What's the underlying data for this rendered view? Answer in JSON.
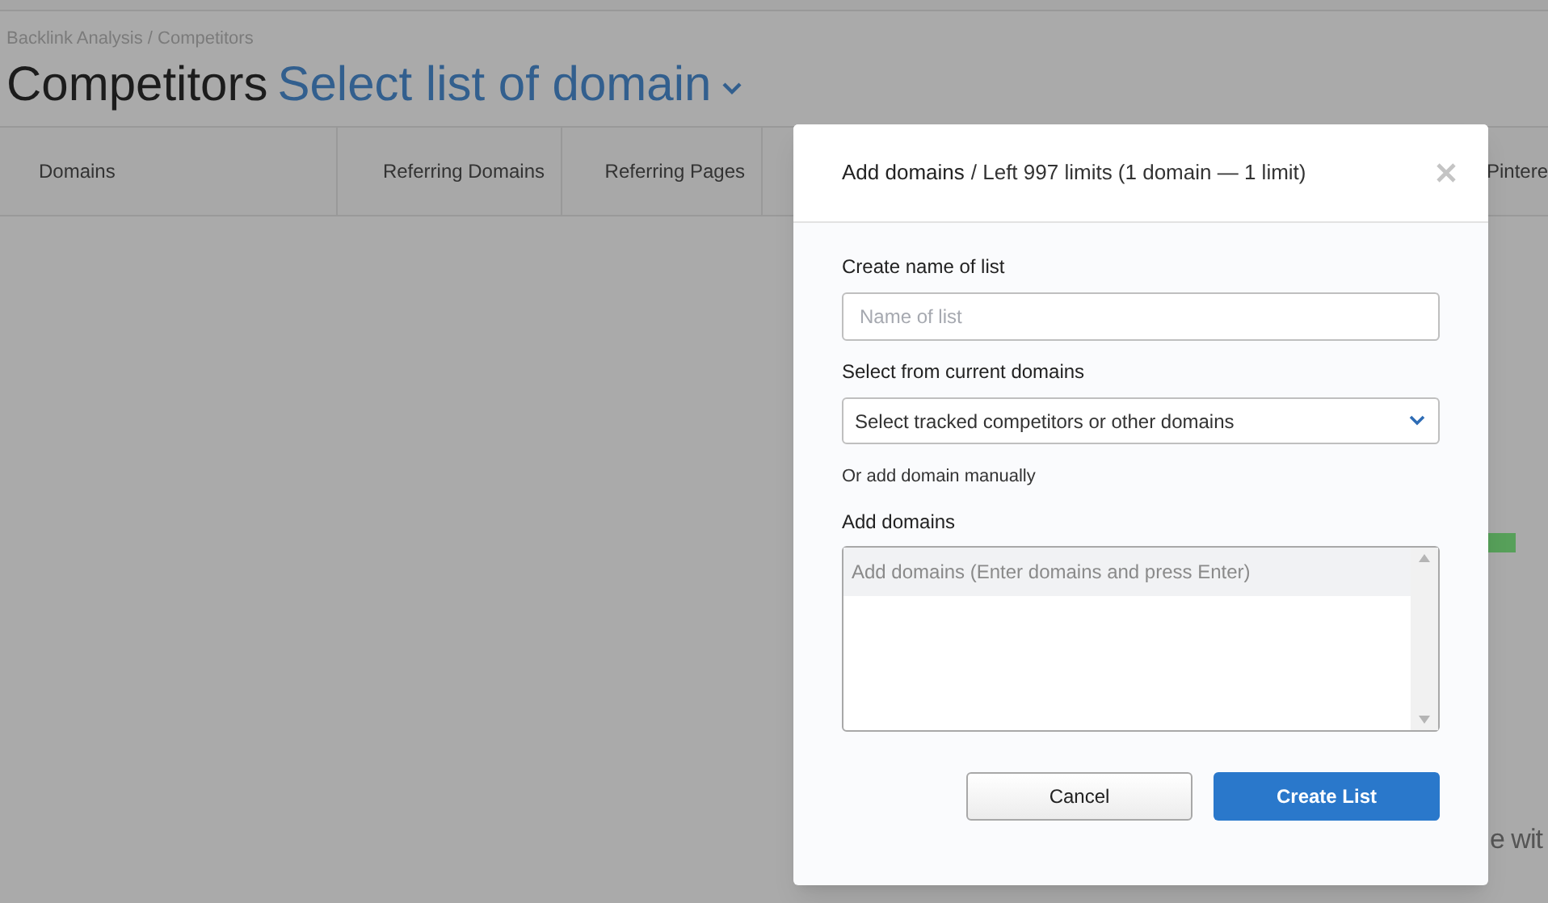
{
  "breadcrumb": "Backlink Analysis / Competitors",
  "title": "Competitors",
  "list_selector": "Select list of domain",
  "table": {
    "columns": [
      {
        "label": "Domains"
      },
      {
        "label": "Referring Domains"
      },
      {
        "label": "Referring Pages"
      },
      {
        "label": "Pintere"
      }
    ]
  },
  "background_text": "e wit",
  "dialog": {
    "title": "Add domains",
    "subtitle": "/ Left 997 limits (1 domain — 1 limit)",
    "name_label": "Create name of list",
    "name_placeholder": "Name of list",
    "select_label": "Select from current domains",
    "select_value": "Select tracked competitors or other domains",
    "manual_note": "Or add domain manually",
    "domains_label": "Add domains",
    "domains_placeholder": "Add domains (Enter domains and press Enter)",
    "buttons": [
      {
        "label": "Cancel",
        "kind": "secondary"
      },
      {
        "label": "Create List",
        "kind": "primary"
      }
    ]
  }
}
